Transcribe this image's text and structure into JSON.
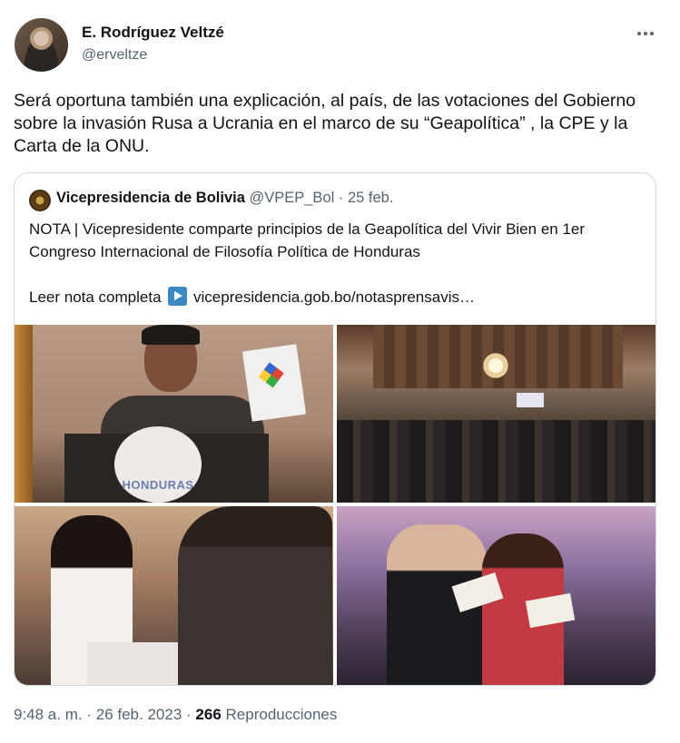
{
  "tweet": {
    "author_name": "E. Rodríguez Veltzé",
    "author_handle": "@erveltze",
    "text": "Será oportuna también una explicación, al país, de las votaciones del Gobierno sobre la invasión Rusa a Ucrania en el marco de su “Geapolítica” , la CPE y la Carta de la ONU.",
    "more_icon": "more-horizontal-icon"
  },
  "quote": {
    "name": "Vicepresidencia de Bolivia",
    "handle": "@VPEP_Bol",
    "separator": "·",
    "date": "25 feb.",
    "text": "NOTA | Vicepresidente comparte principios de la Geapolítica del Vivir Bien en 1er Congreso Internacional de Filosofía Política de Honduras",
    "link_prefix": "Leer nota completa",
    "link_icon": "play-button-icon",
    "link_url": "vicepresidencia.gob.bo/notasprensavis…",
    "photo_text": {
      "podium_seal": "HONDURAS"
    }
  },
  "meta": {
    "time": "9:48 a. m.",
    "sep1": "·",
    "date": "26 feb. 2023",
    "sep2": "·",
    "views_count": "266",
    "views_label": "Reproducciones"
  },
  "colors": {
    "primary_text": "#0f1419",
    "secondary_text": "#536471",
    "border": "#cfd9de",
    "link_icon_bg": "#3b88c3"
  }
}
